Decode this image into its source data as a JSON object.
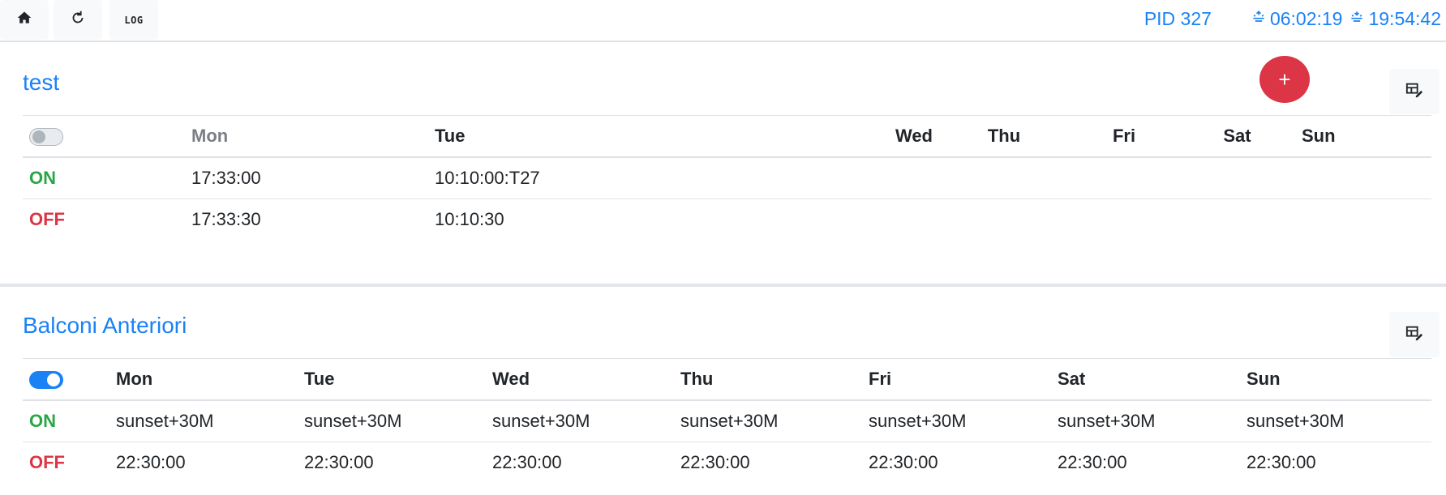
{
  "nav": {
    "log_label": "LOG"
  },
  "status": {
    "pid": "PID 327",
    "sunrise": "06:02:19",
    "sunset": "19:54:42"
  },
  "colors": {
    "accent": "#1a82f5",
    "on": "#28a745",
    "off": "#dc3545"
  },
  "icons": [
    "home-icon",
    "refresh-icon",
    "sunrise-icon",
    "sunset-icon",
    "plus-icon",
    "edit-table-icon",
    "toggle-switch"
  ],
  "fab": {
    "label": "+"
  },
  "cards": [
    {
      "title": "test",
      "enabled": false,
      "days": [
        "Mon",
        "Tue",
        "Wed",
        "Thu",
        "Fri",
        "Sat",
        "Sun"
      ],
      "on_label": "ON",
      "off_label": "OFF",
      "on": [
        "17:33:00",
        "10:10:00:T27",
        "",
        "",
        "",
        "",
        ""
      ],
      "off": [
        "17:33:30",
        "10:10:30",
        "",
        "",
        "",
        "",
        ""
      ]
    },
    {
      "title": "Balconi Anteriori",
      "enabled": true,
      "days": [
        "Mon",
        "Tue",
        "Wed",
        "Thu",
        "Fri",
        "Sat",
        "Sun"
      ],
      "on_label": "ON",
      "off_label": "OFF",
      "on": [
        "sunset+30M",
        "sunset+30M",
        "sunset+30M",
        "sunset+30M",
        "sunset+30M",
        "sunset+30M",
        "sunset+30M"
      ],
      "off": [
        "22:30:00",
        "22:30:00",
        "22:30:00",
        "22:30:00",
        "22:30:00",
        "22:30:00",
        "22:30:00"
      ]
    }
  ]
}
